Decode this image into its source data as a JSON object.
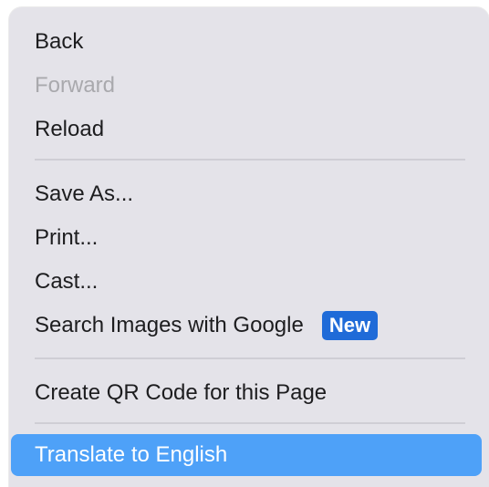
{
  "menu": {
    "items": [
      {
        "label": "Back",
        "enabled": true
      },
      {
        "label": "Forward",
        "enabled": false
      },
      {
        "label": "Reload",
        "enabled": true
      },
      {
        "label": "Save As...",
        "enabled": true
      },
      {
        "label": "Print...",
        "enabled": true
      },
      {
        "label": "Cast...",
        "enabled": true
      },
      {
        "label": "Search Images with Google",
        "enabled": true,
        "badge": "New"
      },
      {
        "label": "Create QR Code for this Page",
        "enabled": true
      },
      {
        "label": "Translate to English",
        "enabled": true,
        "highlighted": true
      }
    ]
  },
  "colors": {
    "menu_background": "#e4e3e9",
    "highlight": "#4ea1f8",
    "badge": "#1f6bd8",
    "disabled_text": "#a9a9ad"
  }
}
